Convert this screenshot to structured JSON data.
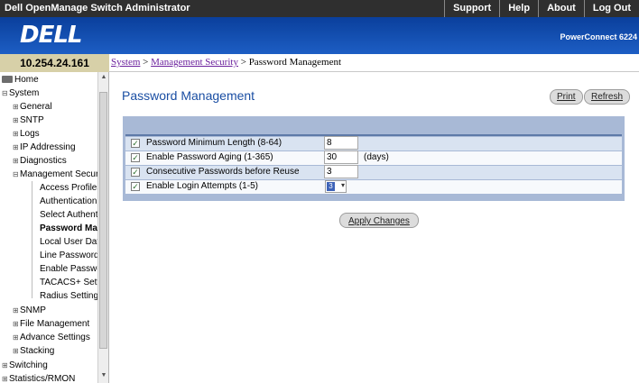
{
  "topbar": {
    "title": "Dell OpenManage Switch Administrator",
    "links": [
      "Support",
      "Help",
      "About",
      "Log Out"
    ]
  },
  "header": {
    "logo": "DELL",
    "product": "PowerConnect 6224"
  },
  "ip": "10.254.24.161",
  "breadcrumb": {
    "system": "System",
    "sep1": ">",
    "security": "Management Security",
    "sep2": ">",
    "current": "Password Management"
  },
  "sidebar": {
    "items": [
      {
        "label": "Home",
        "icon": "folder-icon"
      },
      {
        "label": "System",
        "expander": "⊟"
      },
      {
        "label": "General",
        "expander": "⊞"
      },
      {
        "label": "SNTP",
        "expander": "⊞"
      },
      {
        "label": "Logs",
        "expander": "⊞"
      },
      {
        "label": "IP Addressing",
        "expander": "⊞"
      },
      {
        "label": "Diagnostics",
        "expander": "⊞"
      },
      {
        "label": "Management Secur",
        "expander": "⊟"
      },
      {
        "label": "Access Profiles"
      },
      {
        "label": "Authentication P"
      },
      {
        "label": "Select Authentic"
      },
      {
        "label": "Password Mana"
      },
      {
        "label": "Local User Datal"
      },
      {
        "label": "Line Password"
      },
      {
        "label": "Enable Passwor"
      },
      {
        "label": "TACACS+ Settir"
      },
      {
        "label": "Radius Settings"
      },
      {
        "label": "SNMP",
        "expander": "⊞"
      },
      {
        "label": "File Management",
        "expander": "⊞"
      },
      {
        "label": "Advance Settings",
        "expander": "⊞"
      },
      {
        "label": "Stacking",
        "expander": "⊞"
      },
      {
        "label": "Switching",
        "expander": "⊞"
      },
      {
        "label": "Statistics/RMON",
        "expander": "⊞"
      }
    ]
  },
  "main": {
    "title": "Password Management",
    "print_label": "Print",
    "refresh_label": "Refresh",
    "apply_label": "Apply Changes",
    "rows": [
      {
        "label": "Password Minimum Length (8-64)",
        "value": "8",
        "unit": "",
        "checked": true
      },
      {
        "label": "Enable Password Aging (1-365)",
        "value": "30",
        "unit": "(days)",
        "checked": true
      },
      {
        "label": "Consecutive Passwords before Reuse",
        "value": "3",
        "unit": "",
        "checked": true
      },
      {
        "label": "Enable Login Attempts (1-5)",
        "value": "3",
        "unit": "",
        "checked": true
      }
    ]
  },
  "colors": {
    "topbar": "#2f2f2f",
    "header": "#1d5ec4",
    "panel": "#a8b9d6",
    "title": "#1a4ea3"
  }
}
